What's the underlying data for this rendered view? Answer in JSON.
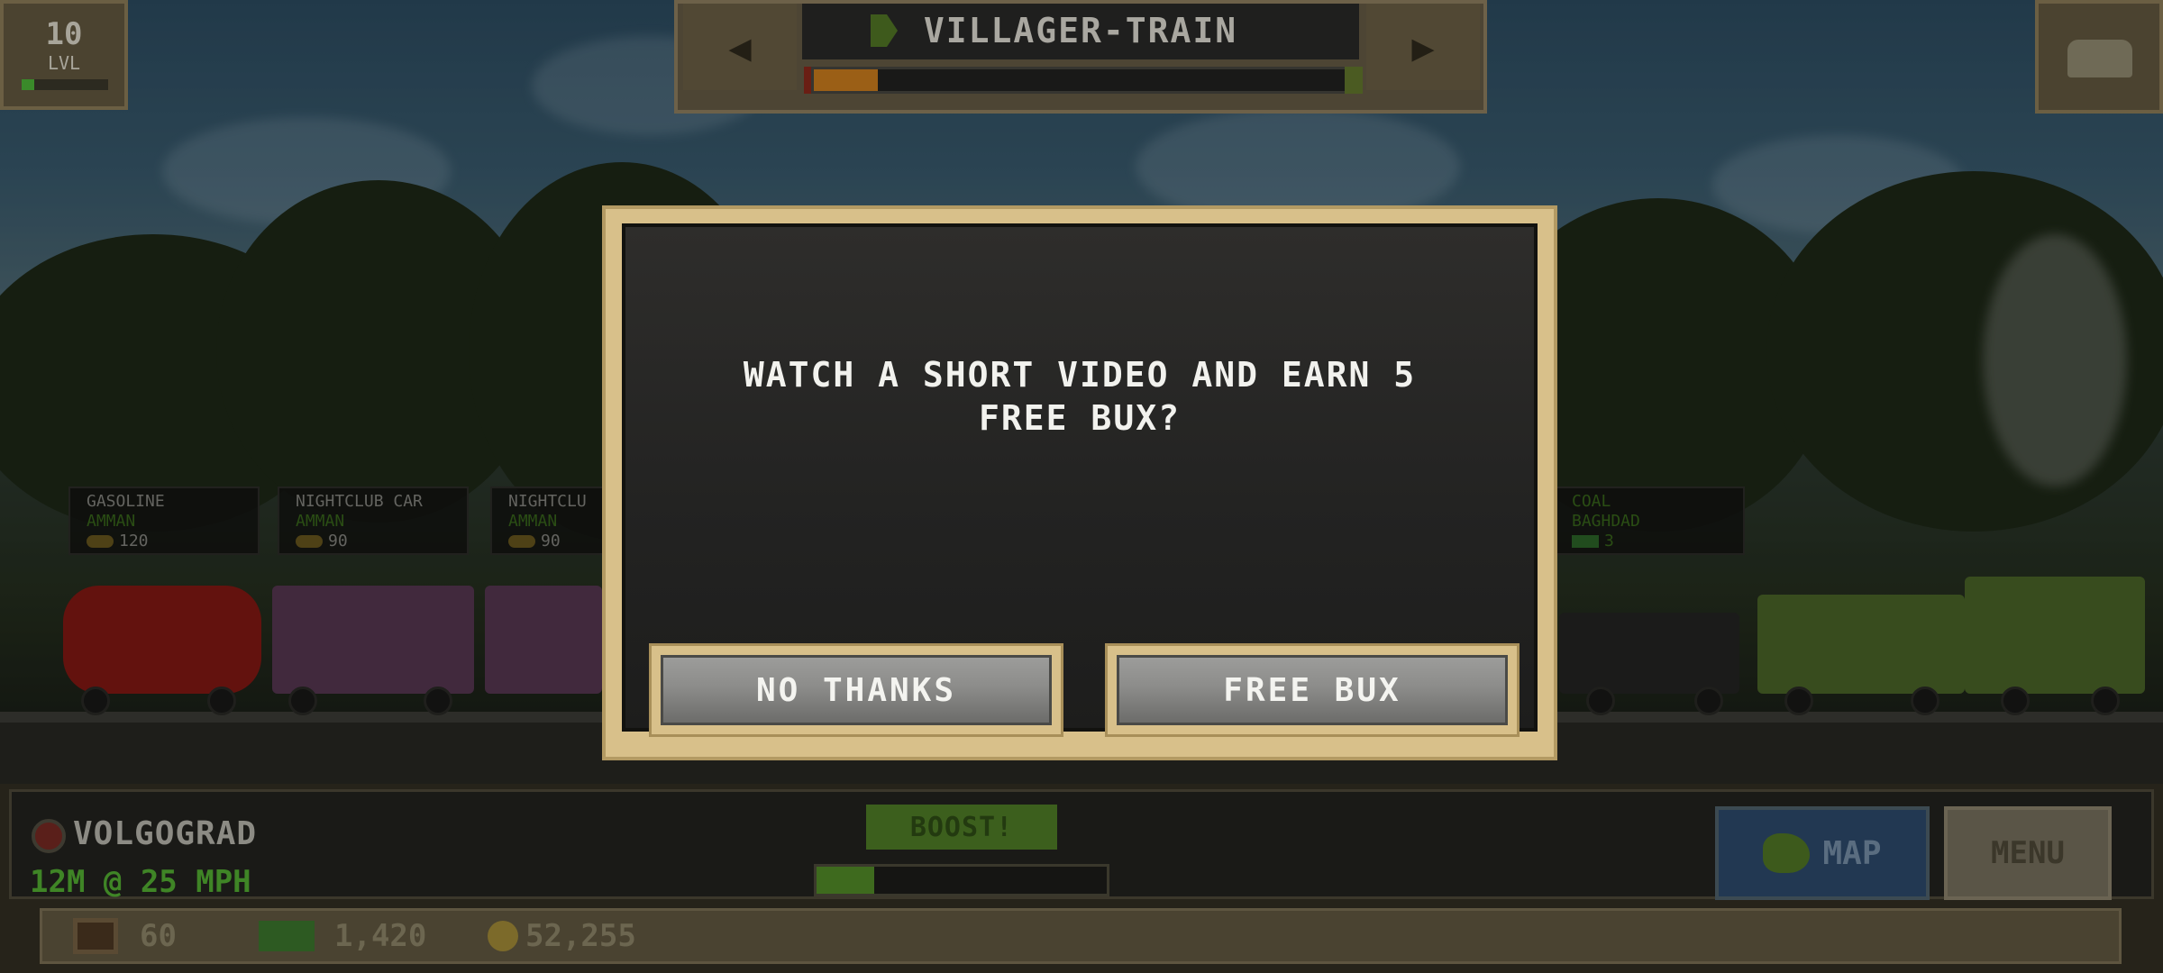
{
  "top_hud": {
    "level": {
      "number": "10",
      "label": "LVL"
    },
    "train_name": "VILLAGER-TRAIN",
    "prev_arrow": "◀",
    "next_arrow": "▶",
    "fuel_level": 0.12
  },
  "cars": [
    {
      "name": "GASOLINE",
      "destination": "AMMAN",
      "value": "120",
      "value_type": "coins"
    },
    {
      "name": "NIGHTCLUB CAR",
      "destination": "AMMAN",
      "value": "90",
      "value_type": "coins"
    },
    {
      "name": "NIGHTCLU",
      "destination": "AMMAN",
      "value": "90",
      "value_type": "coins"
    },
    {
      "name": "COAL",
      "destination": "BAGHDAD",
      "value": "3",
      "value_type": "cash"
    }
  ],
  "dialog": {
    "message": "WATCH A SHORT VIDEO AND EARN 5 FREE BUX?",
    "no_button": "NO THANKS",
    "yes_button": "FREE BUX"
  },
  "bottom_hud": {
    "station": "VOLGOGRAD",
    "speed": "12M @ 25 MPH",
    "boost_label": "BOOST!",
    "boost_level": 0.2,
    "map_label": "MAP",
    "menu_label": "MENU",
    "resources": {
      "tickets": "60",
      "cash": "1,420",
      "coins": "52,255"
    }
  },
  "colors": {
    "dialog_frame": "#d8c08a",
    "dialog_bg": "#232322",
    "button_face": "#8c8c8a",
    "speed_text": "#3f8526",
    "destination_text": "#3b6b1c"
  }
}
